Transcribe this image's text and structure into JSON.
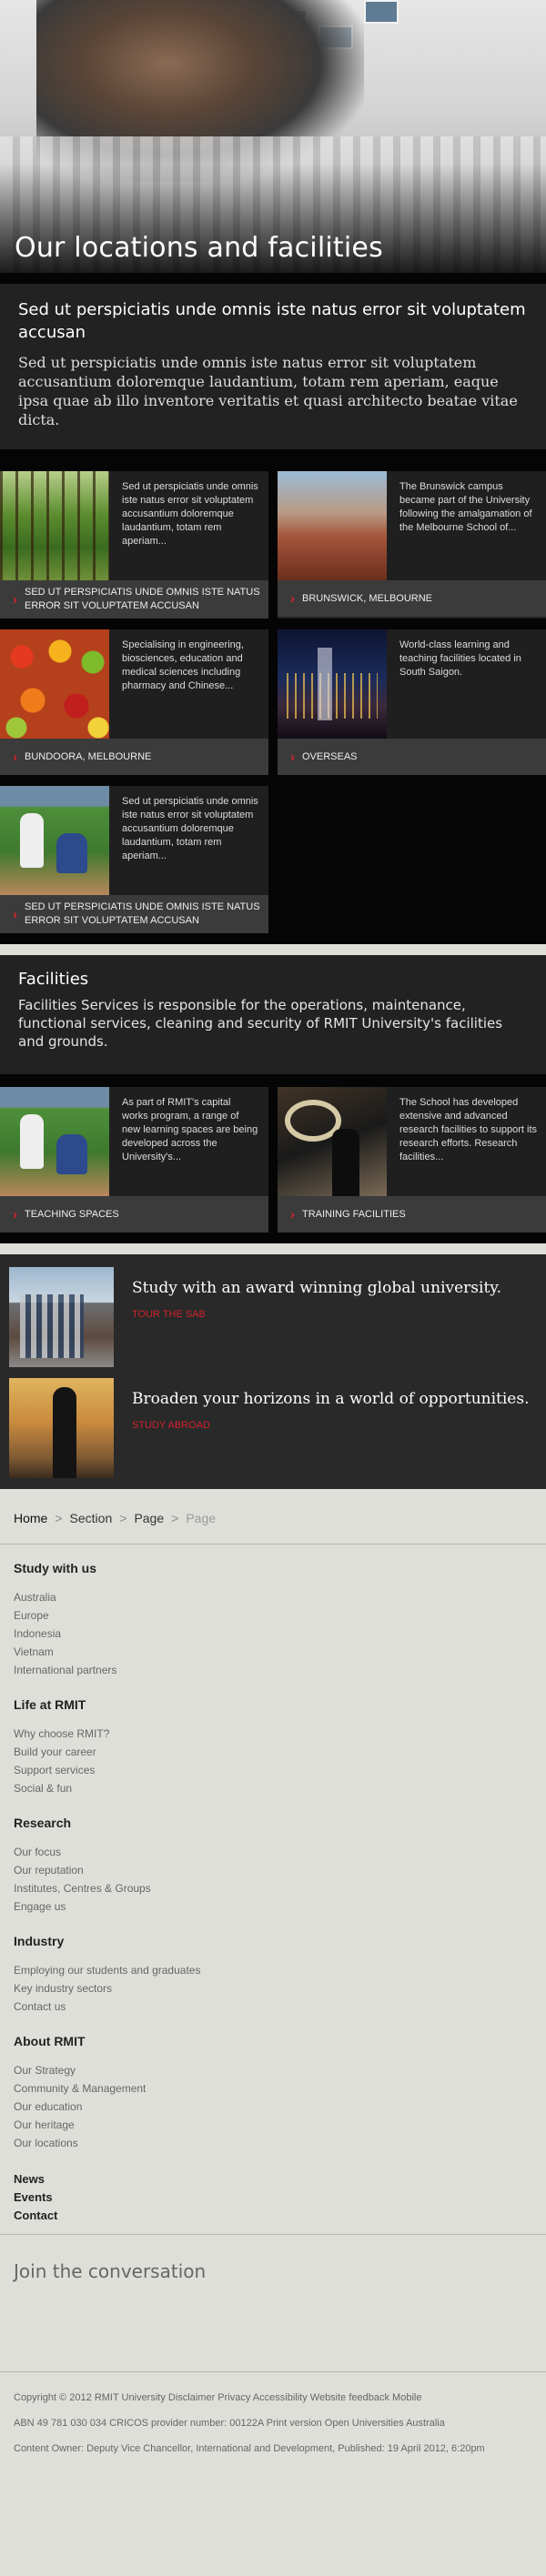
{
  "hero": {
    "title": "Our locations and facilities"
  },
  "intro": {
    "heading": "Sed ut perspiciatis unde omnis iste natus error sit voluptatem accusan",
    "body": "Sed ut perspiciatis unde omnis iste natus error sit voluptatem accusantium doloremque laudantium, totam rem aperiam, eaque ipsa quae ab illo inventore veritatis et quasi architecto beatae vitae dicta."
  },
  "locations": [
    {
      "desc": "Sed ut perspiciatis unde omnis iste natus error sit voluptatem accusantium doloremque laudantium, totam rem aperiam...",
      "caption": "Sed ut perspiciatis unde omnis iste natus error sit voluptatem accusan"
    },
    {
      "desc": "The Brunswick campus became part of the University following the amalgamation of the Melbourne School of...",
      "caption": "Brunswick, Melbourne"
    },
    {
      "desc": "Specialising in engineering, biosciences, education and medical sciences including pharmacy and Chinese...",
      "caption": "Bundoora, Melbourne"
    },
    {
      "desc": "World-class learning and teaching facilities located in South Saigon.",
      "caption": "Overseas"
    },
    {
      "desc": "Sed ut perspiciatis unde omnis iste natus error sit voluptatem accusantium doloremque laudantium, totam rem aperiam...",
      "caption": "Sed ut perspiciatis unde omnis iste natus error sit voluptatem accusan"
    }
  ],
  "facilities": {
    "heading": "Facilities",
    "body": "Facilities Services is responsible for the operations, maintenance, functional services, cleaning and security of RMIT University's facilities and grounds.",
    "cards": [
      {
        "desc": "As part of RMIT's capital works program, a range of new learning spaces are being developed across the University's...",
        "caption": "Teaching spaces"
      },
      {
        "desc": "The School has developed extensive and advanced research facilities to support its research efforts. Research facilities...",
        "caption": "Training facilities"
      }
    ]
  },
  "promos": [
    {
      "title": "Study with an award winning global university.",
      "link": "Tour the SAB"
    },
    {
      "title": "Broaden your horizons in a world of opportunities.",
      "link": "Study abroad"
    }
  ],
  "breadcrumb": {
    "home": "Home",
    "sep": ">",
    "section": "Section",
    "page": "Page",
    "current": "Page"
  },
  "footer_nav": {
    "study": {
      "heading": "Study with us",
      "items": [
        "Australia",
        "Europe",
        "Indonesia",
        "Vietnam",
        "International partners"
      ]
    },
    "life": {
      "heading": "Life at RMIT",
      "items": [
        "Why choose RMIT?",
        "Build your career",
        "Support services",
        "Social & fun"
      ]
    },
    "research": {
      "heading": "Research",
      "items": [
        "Our focus",
        "Our reputation",
        "Institutes, Centres & Groups",
        "Engage us"
      ]
    },
    "industry": {
      "heading": "Industry",
      "items": [
        "Employing our students and graduates",
        "Key industry sectors",
        "Contact us"
      ]
    },
    "about": {
      "heading": "About RMIT",
      "items": [
        "Our Strategy",
        "Community & Management",
        "Our education",
        "Our heritage",
        "Our locations"
      ]
    },
    "solo": [
      "News",
      "Events",
      "Contact"
    ]
  },
  "join": "Join the conversation",
  "legal": {
    "line1": "Copyright © 2012 RMIT University Disclaimer Privacy Accessibility Website feedback Mobile",
    "line2": "ABN 49 781 030 034 CRICOS provider number: 00122A Print version Open Universities Australia",
    "line3": "Content Owner: Deputy Vice Chancellor, International and Development, Published: 19 April 2012, 6:20pm"
  },
  "colors": {
    "accent": "#d3232e",
    "panel": "#222222",
    "page_bg": "#dfdfda"
  }
}
